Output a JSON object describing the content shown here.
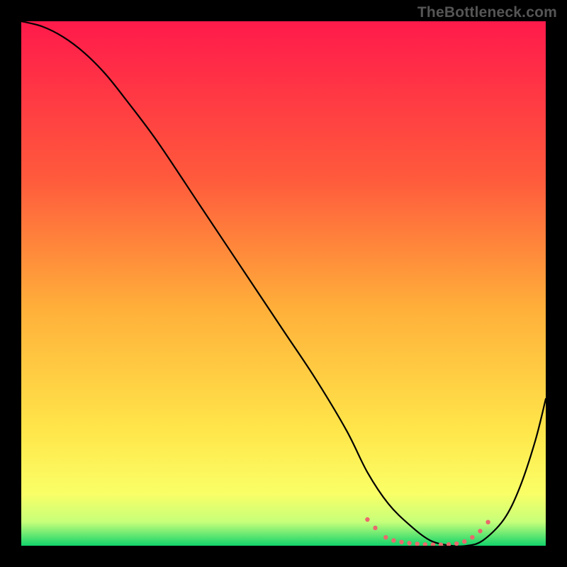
{
  "watermark": "TheBottleneck.com",
  "chart_data": {
    "type": "line",
    "title": "",
    "xlabel": "",
    "ylabel": "",
    "xlim": [
      0,
      100
    ],
    "ylim": [
      0,
      100
    ],
    "background_gradient": {
      "stops": [
        {
          "offset": 0.0,
          "color": "#ff1a4b"
        },
        {
          "offset": 0.3,
          "color": "#ff5a3c"
        },
        {
          "offset": 0.55,
          "color": "#ffb03a"
        },
        {
          "offset": 0.78,
          "color": "#ffe64a"
        },
        {
          "offset": 0.9,
          "color": "#faff66"
        },
        {
          "offset": 0.955,
          "color": "#c6ff7a"
        },
        {
          "offset": 1.0,
          "color": "#12d36b"
        }
      ]
    },
    "series": [
      {
        "name": "curve",
        "color": "#000000",
        "x": [
          0,
          4,
          8,
          12,
          16,
          20,
          26,
          34,
          42,
          50,
          56,
          62,
          66,
          70,
          74,
          78,
          82,
          85,
          88,
          92,
          95,
          98,
          100
        ],
        "y": [
          100,
          99,
          97,
          94,
          90,
          85,
          77,
          65,
          53,
          41,
          32,
          22,
          14,
          8,
          4,
          1,
          0,
          0,
          1,
          5,
          11,
          20,
          28
        ]
      }
    ],
    "trough_markers": {
      "color": "#e96a6c",
      "radius": 3.2,
      "points": [
        {
          "x": 66.0,
          "y": 5.0
        },
        {
          "x": 67.5,
          "y": 3.4
        },
        {
          "x": 69.5,
          "y": 1.6
        },
        {
          "x": 71.0,
          "y": 1.0
        },
        {
          "x": 72.5,
          "y": 0.7
        },
        {
          "x": 74.0,
          "y": 0.5
        },
        {
          "x": 75.5,
          "y": 0.35
        },
        {
          "x": 77.0,
          "y": 0.25
        },
        {
          "x": 78.5,
          "y": 0.2
        },
        {
          "x": 80.0,
          "y": 0.2
        },
        {
          "x": 81.5,
          "y": 0.25
        },
        {
          "x": 83.0,
          "y": 0.4
        },
        {
          "x": 84.5,
          "y": 0.8
        },
        {
          "x": 86.0,
          "y": 1.6
        },
        {
          "x": 87.5,
          "y": 2.8
        },
        {
          "x": 89.0,
          "y": 4.5
        }
      ]
    }
  }
}
